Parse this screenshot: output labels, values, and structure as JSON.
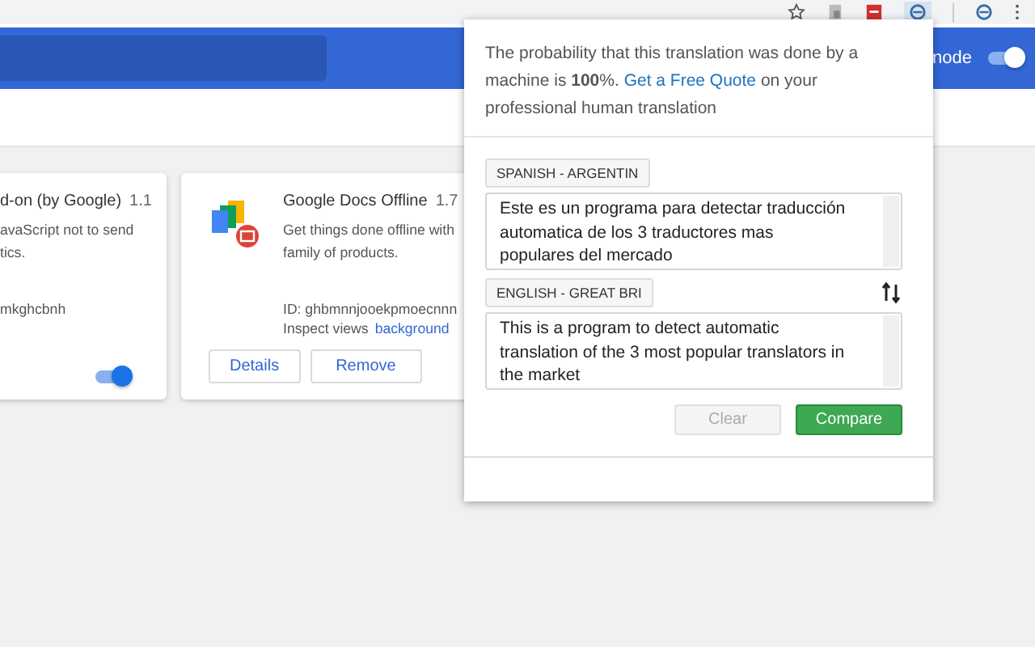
{
  "header": {
    "mode_label": "node",
    "mode_toggle": {
      "on": true
    }
  },
  "cards": [
    {
      "title": "d-on (by Google)",
      "version": "1.1",
      "description": [
        "avaScript not to send",
        "tics."
      ],
      "id": "mkghcbnh",
      "toggle": {
        "on": true
      }
    },
    {
      "title": "Google Docs Offline",
      "version": "1.7",
      "description": [
        "Get things done offline with",
        "family of products."
      ],
      "id": "ID: ghbmnnjooekpmoecnnn",
      "inspect_label": "Inspect views",
      "inspect_link": "background",
      "buttons": [
        "Details",
        "Remove"
      ]
    }
  ],
  "popup": {
    "message_start": "The probability that this translation was done by a machine is **100**%. ",
    "quote_link": "Get a Free Quote",
    "message_end": " on your professional human translation",
    "source_language": "SPANISH - ARGENTIN",
    "source_text": "Este es un programa para detectar traducción automatica de los 3 traductores mas populares del mercado",
    "target_language": "ENGLISH - GREAT BRI",
    "target_text": "This is a program to detect automatic translation of the 3 most popular translators in the market",
    "buttons": [
      {
        "label": "Clear",
        "disabled": true
      },
      {
        "label": "Compare",
        "disabled": false
      }
    ]
  }
}
